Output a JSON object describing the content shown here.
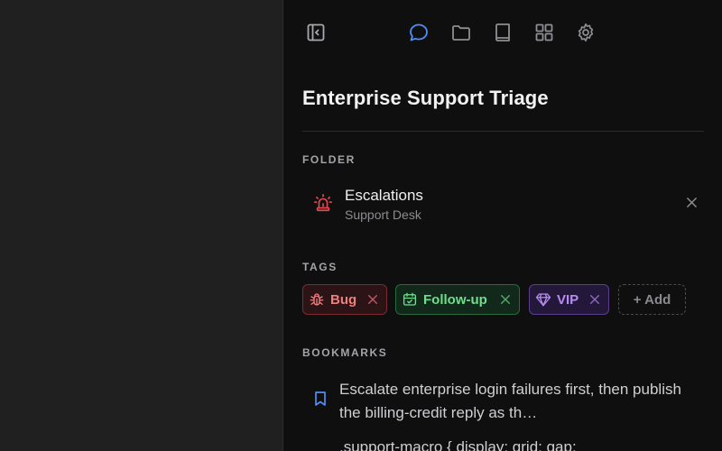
{
  "panel": {
    "title": "Enterprise Support Triage"
  },
  "toolbar": {
    "icons": [
      "collapse-sidebar-icon",
      "chat-bubble-icon",
      "folder-icon",
      "book-icon",
      "grid-icon",
      "gear-icon"
    ],
    "active_icon": "chat-bubble-icon",
    "accent_color": "#4f8ef7"
  },
  "folder": {
    "section_label": "FOLDER",
    "name": "Escalations",
    "subtitle": "Support Desk",
    "icon": "siren-icon",
    "icon_color": "#e0484f"
  },
  "tags": {
    "section_label": "TAGS",
    "items": [
      {
        "label": "Bug",
        "icon": "bug-icon",
        "color": "#f07f7f"
      },
      {
        "label": "Follow-up",
        "icon": "calendar-icon",
        "color": "#6fdf8f"
      },
      {
        "label": "VIP",
        "icon": "gem-icon",
        "color": "#b78cf0"
      }
    ],
    "add_label": "+ Add"
  },
  "bookmarks": {
    "section_label": "BOOKMARKS",
    "items": [
      {
        "icon": "bookmark-icon",
        "text": "Escalate enterprise login failures first, then publish the billing-credit reply as th…"
      }
    ],
    "code_preview": ".support-macro { display: grid; gap:"
  }
}
